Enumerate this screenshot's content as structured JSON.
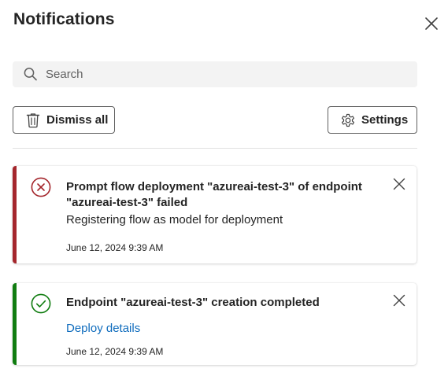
{
  "panel": {
    "title": "Notifications",
    "close_icon": "close-icon"
  },
  "search": {
    "placeholder": "Search",
    "value": "",
    "icon": "search-icon"
  },
  "actions": {
    "dismiss_all_label": "Dismiss all",
    "dismiss_icon": "trash-icon",
    "settings_label": "Settings",
    "settings_icon": "gear-icon"
  },
  "notifications": [
    {
      "status": "error",
      "status_icon": "error-circle-icon",
      "accent_color": "#a4262c",
      "title": "Prompt flow deployment \"azureai-test-3\" of endpoint \"azureai-test-3\" failed",
      "description": "Registering flow as model for deployment",
      "timestamp": "June 12, 2024 9:39 AM"
    },
    {
      "status": "success",
      "status_icon": "success-check-icon",
      "accent_color": "#107c10",
      "title": "Endpoint \"azureai-test-3\" creation completed",
      "link": "Deploy details",
      "timestamp": "June 12, 2024 9:39 AM"
    }
  ],
  "colors": {
    "link": "#0f6cbd",
    "search_bg": "#f3f3f3",
    "text": "#242424"
  }
}
